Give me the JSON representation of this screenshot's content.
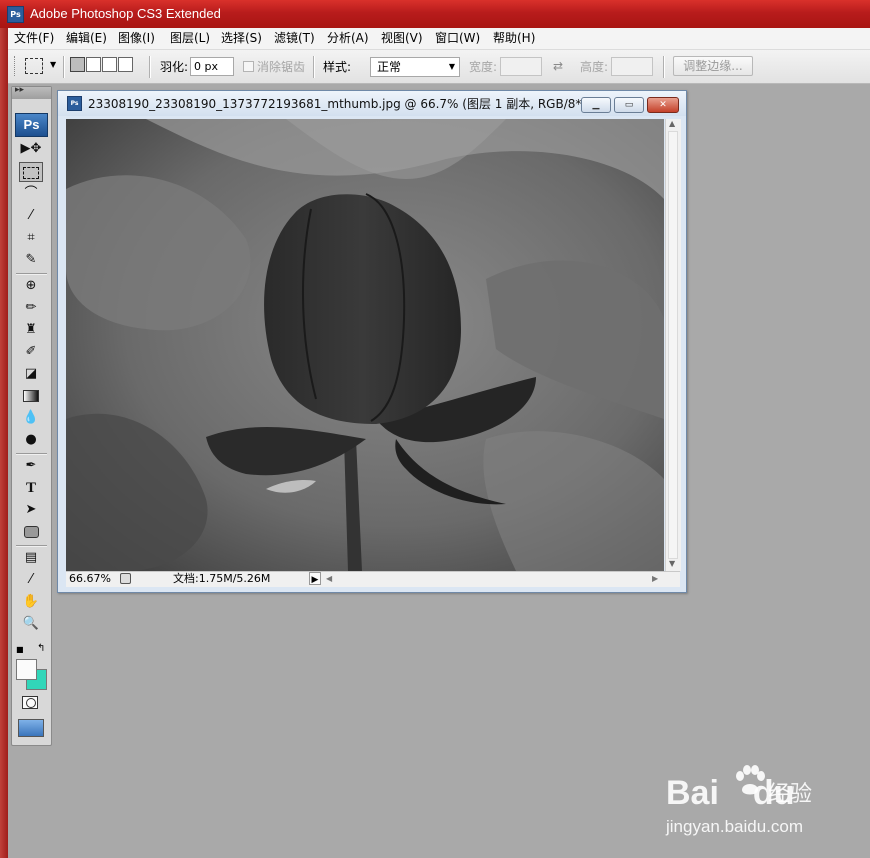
{
  "app": {
    "title": "Adobe Photoshop CS3 Extended",
    "logo": "Ps"
  },
  "menubar": {
    "items": [
      "文件(F)",
      "编辑(E)",
      "图像(I)",
      "图层(L)",
      "选择(S)",
      "滤镜(T)",
      "分析(A)",
      "视图(V)",
      "窗口(W)",
      "帮助(H)"
    ]
  },
  "options": {
    "feather_label": "羽化:",
    "feather_value": "0 px",
    "antialias_label": "消除锯齿",
    "style_label": "样式:",
    "style_value": "正常",
    "width_label": "宽度:",
    "height_label": "高度:",
    "refine_edge_label": "调整边缘..."
  },
  "toolbox": {
    "tools": [
      "move-tool",
      "marquee-tool",
      "lasso-tool",
      "quick-selection-tool",
      "crop-tool",
      "slice-tool",
      "spot-healing-tool",
      "brush-tool",
      "clone-stamp-tool",
      "history-brush-tool",
      "eraser-tool",
      "gradient-tool",
      "blur-tool",
      "dodge-tool",
      "pen-tool",
      "type-tool",
      "path-selection-tool",
      "shape-tool",
      "notes-tool",
      "eyedropper-tool",
      "hand-tool",
      "zoom-tool"
    ],
    "active_tool": "marquee-tool",
    "foreground_color": "#fbfbfb",
    "background_color": "#31d6b9"
  },
  "document": {
    "title": "23308190_23308190_1373772193681_mthumb.jpg @ 66.7% (图层 1 副本, RGB/8*)",
    "zoom": "66.67%",
    "doc_size": "文档:1.75M/5.26M"
  },
  "watermark": {
    "brand": "Bai",
    "brand_suffix": "du",
    "cn": "经验",
    "url": "jingyan.baidu.com"
  }
}
